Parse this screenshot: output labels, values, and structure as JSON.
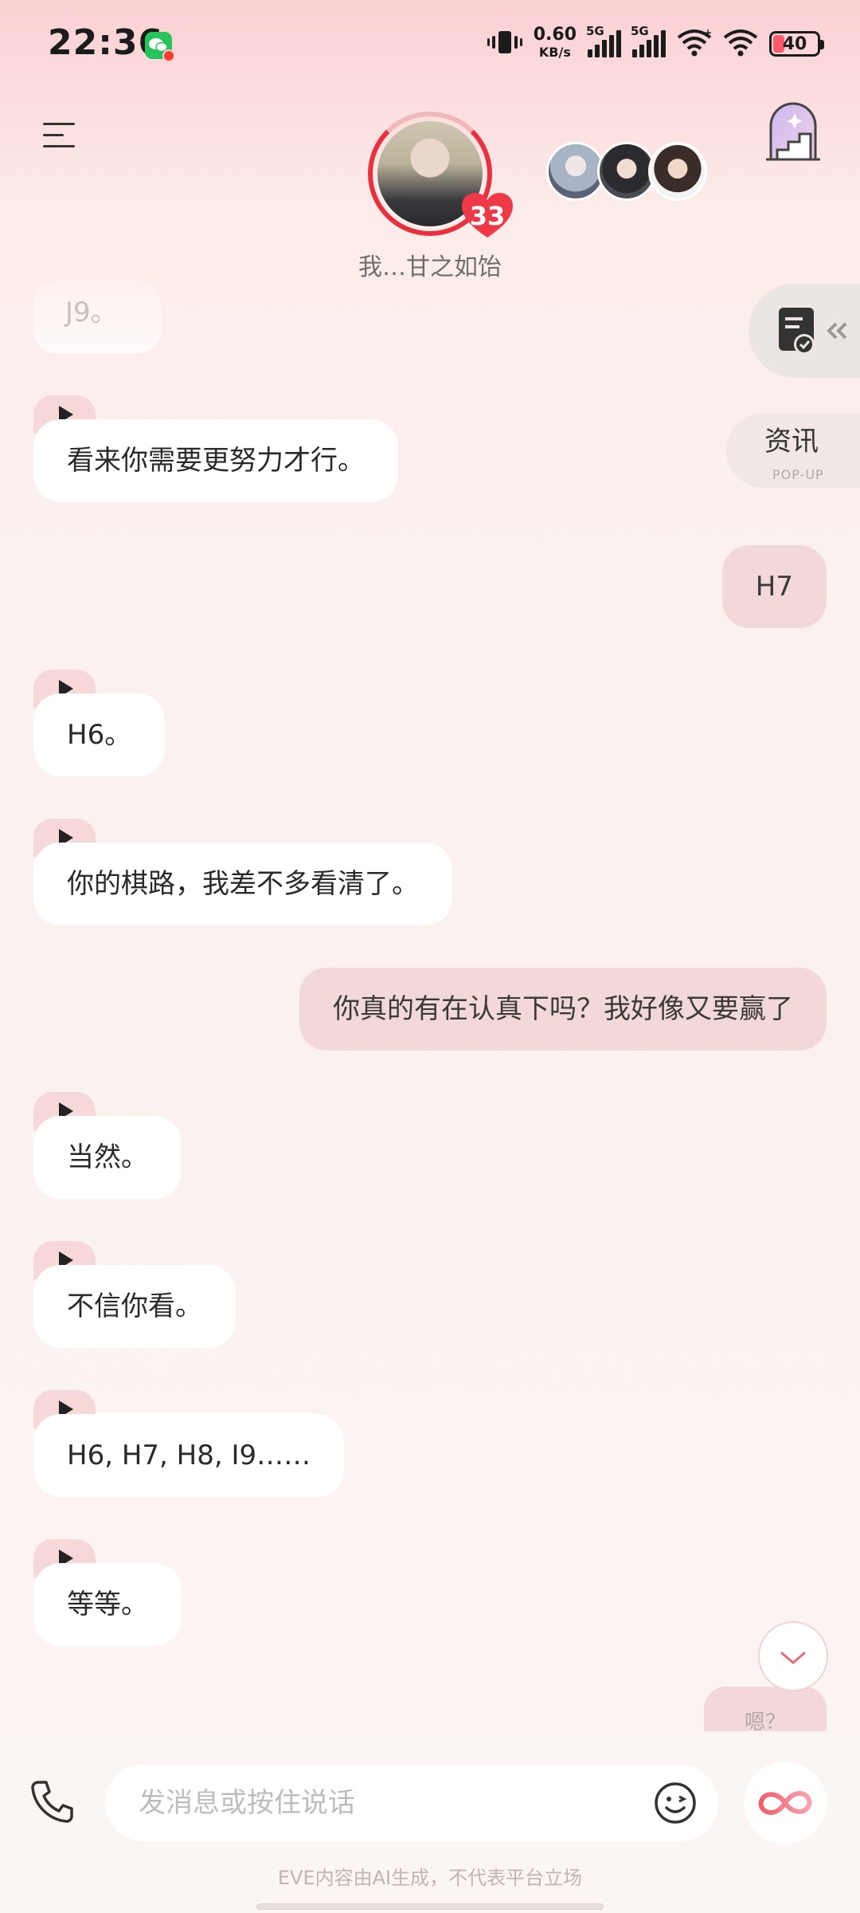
{
  "status_bar": {
    "time": "22:36",
    "net_speed": "0.60",
    "net_unit": "KB/s",
    "signal1_tag": "5G",
    "signal2_tag": "5G",
    "battery": "40",
    "icons": [
      "wechat-icon",
      "vibrate-icon",
      "signal-icon",
      "signal-icon",
      "wifi-icon",
      "wifi-icon",
      "battery-icon"
    ]
  },
  "header": {
    "character_name": "我…甘之如饴",
    "intimacy_level": "33",
    "accent": "#e8303e"
  },
  "side_actions": {
    "news_label": "资讯",
    "news_sub": "POP-UP"
  },
  "messages": {
    "m0": "J9。",
    "m1": "看来你需要更努力才行。",
    "m2": "H7",
    "m3": "H6。",
    "m4": "你的棋路，我差不多看清了。",
    "m5": "你真的有在认真下吗？我好像又要赢了",
    "m6": "当然。",
    "m7": "不信你看。",
    "m8": "H6, H7, H8, I9……",
    "m9": "等等。",
    "m10": "嗯？"
  },
  "composer": {
    "placeholder": "发消息或按住说话"
  },
  "disclaimer": "EVE内容由AI生成，不代表平台立场",
  "colors": {
    "user_bubble": "#f2d8d8",
    "ai_bubble": "#ffffff",
    "background": "#fbf5f3"
  }
}
